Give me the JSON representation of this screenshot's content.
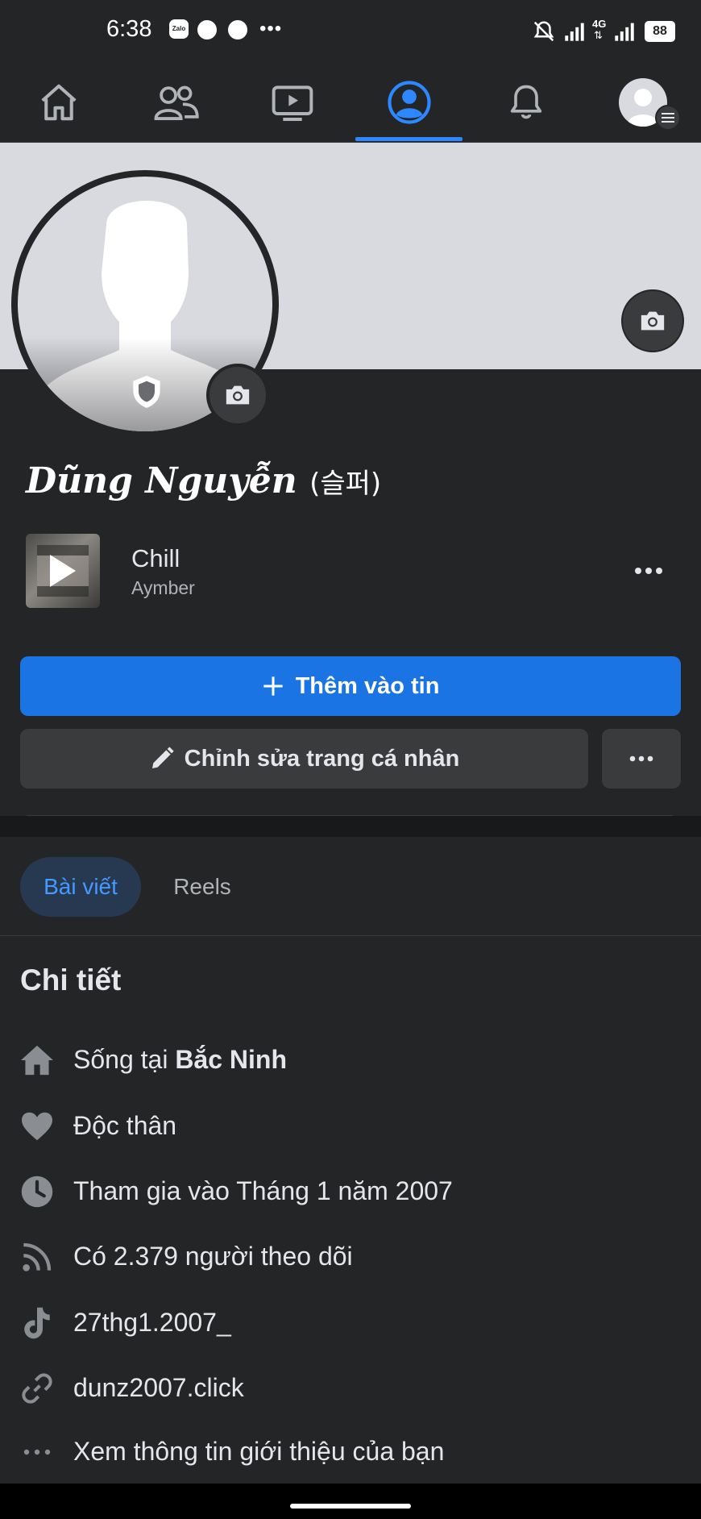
{
  "status_bar": {
    "time": "6:38",
    "app_badge": "Zalo",
    "battery": "88",
    "network": "4G"
  },
  "nav": {
    "items": [
      "home-icon",
      "friends-icon",
      "watch-icon",
      "profile-icon",
      "bell-icon",
      "menu-avatar"
    ],
    "active_index": 3
  },
  "profile": {
    "name": "Dũng Nguyễn",
    "alt_name": "(슬퍼)"
  },
  "music": {
    "title": "Chill",
    "artist": "Aymber"
  },
  "buttons": {
    "add_story": "Thêm vào tin",
    "edit_profile": "Chỉnh sửa trang cá nhân"
  },
  "tabs": [
    {
      "label": "Bài viết",
      "active": true
    },
    {
      "label": "Reels",
      "active": false
    }
  ],
  "details": {
    "title": "Chi tiết",
    "lives_prefix": "Sống tại ",
    "lives_city": "Bắc Ninh",
    "relationship": "Độc thân",
    "joined": "Tham gia vào Tháng 1 năm 2007",
    "followers": "Có 2.379 người theo dõi",
    "tiktok": "27thg1.2007_",
    "website": "dunz2007.click",
    "see_about": "Xem thông tin giới thiệu của bạn"
  },
  "colors": {
    "accent": "#1b74e4",
    "active_tab_text": "#4599ff",
    "background": "#242526"
  }
}
